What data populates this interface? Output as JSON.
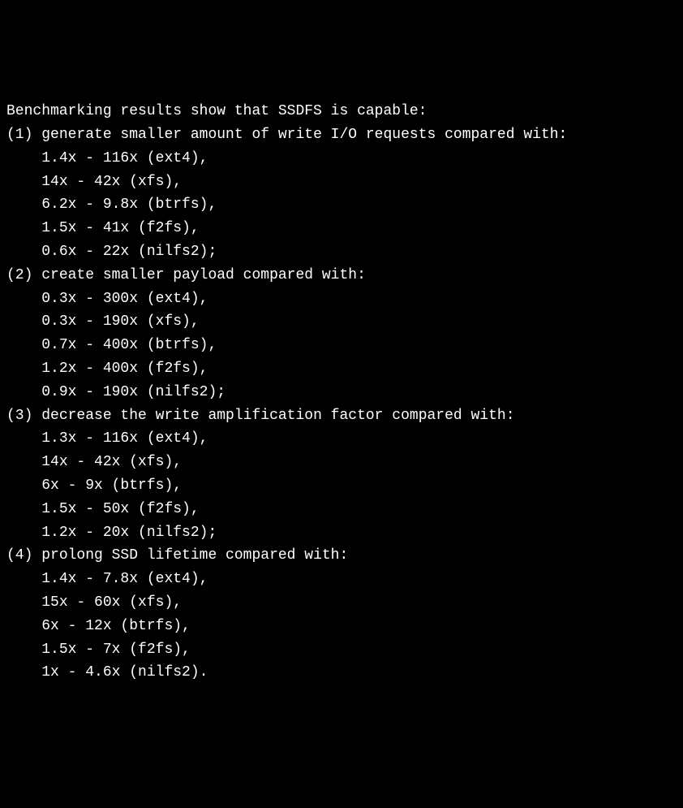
{
  "header": "Benchmarking results show that SSDFS is capable:",
  "sections": [
    {
      "num": "(1)",
      "title": "generate smaller amount of write I/O requests compared with:",
      "items": [
        "1.4x - 116x (ext4),",
        "14x - 42x (xfs),",
        "6.2x - 9.8x (btrfs),",
        "1.5x - 41x (f2fs),",
        "0.6x - 22x (nilfs2);"
      ]
    },
    {
      "num": "(2)",
      "title": "create smaller payload compared with:",
      "items": [
        "0.3x - 300x (ext4),",
        "0.3x - 190x (xfs),",
        "0.7x - 400x (btrfs),",
        "1.2x - 400x (f2fs),",
        "0.9x - 190x (nilfs2);"
      ]
    },
    {
      "num": "(3)",
      "title": "decrease the write amplification factor compared with:",
      "items": [
        "1.3x - 116x (ext4),",
        "14x - 42x (xfs),",
        "6x - 9x (btrfs),",
        "1.5x - 50x (f2fs),",
        "1.2x - 20x (nilfs2);"
      ]
    },
    {
      "num": "(4)",
      "title": "prolong SSD lifetime compared with:",
      "items": [
        "1.4x - 7.8x (ext4),",
        "15x - 60x (xfs),",
        "6x - 12x (btrfs),",
        "1.5x - 7x (f2fs),",
        "1x - 4.6x (nilfs2)."
      ]
    }
  ]
}
